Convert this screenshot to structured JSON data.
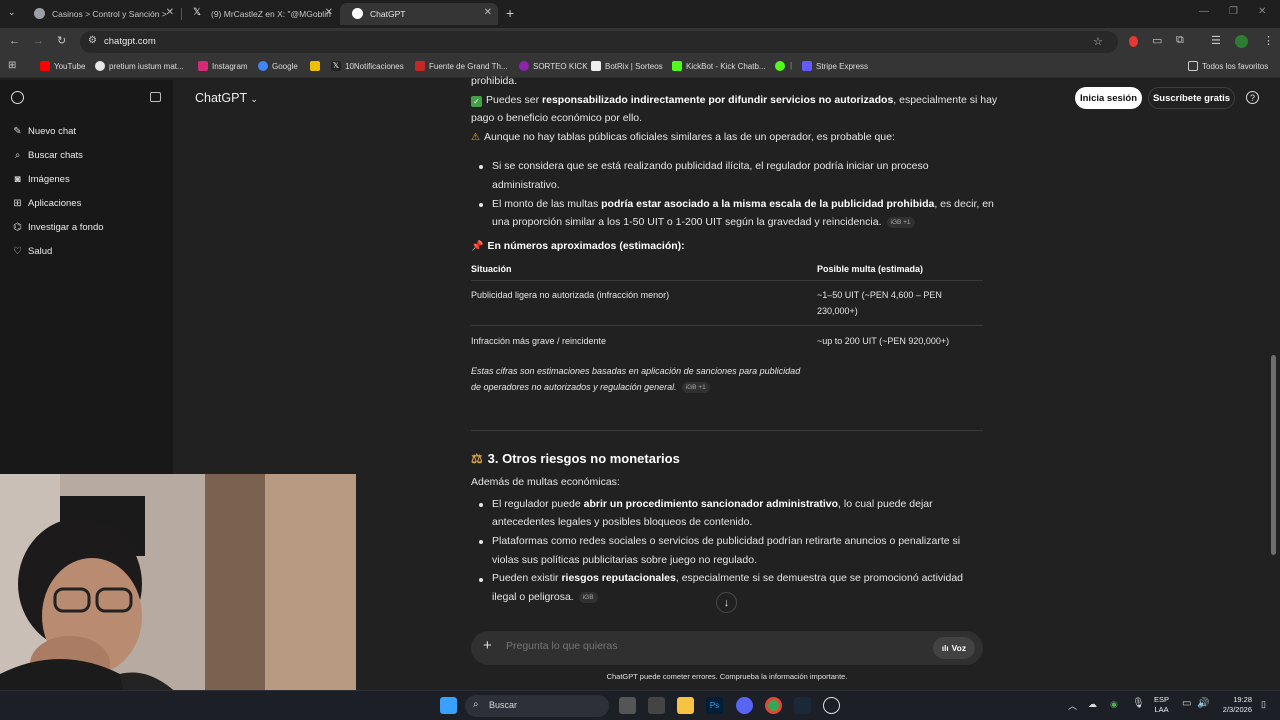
{
  "browser": {
    "tabs": [
      {
        "label": "Casinos > Control y Sanción >",
        "favicon_color": "#9aa0a6"
      },
      {
        "label": "(9) MrCastleZ en X: \"@MGoblin",
        "favicon_color": "#ffffff"
      },
      {
        "label": "ChatGPT",
        "favicon_color": "#ffffff",
        "active": true
      }
    ],
    "url": "chatgpt.com",
    "bookmarks": [
      {
        "label": "YouTube",
        "color": "#ff0000"
      },
      {
        "label": "pretium iustum mat...",
        "color": "#e8e8e8"
      },
      {
        "label": "Instagram",
        "color": "#d62976"
      },
      {
        "label": "Google",
        "color": "#4285f4"
      },
      {
        "label": "",
        "color": "#f0c000"
      },
      {
        "label": "10Notificaciones",
        "color": "#222222"
      },
      {
        "label": "Fuente de Grand Th...",
        "color": "#c62828"
      },
      {
        "label": "SORTEO KICK",
        "color": "#8e24aa"
      },
      {
        "label": "BotRix | Sorteos",
        "color": "#eeeeee"
      },
      {
        "label": "KickBot - Kick Chatb...",
        "color": "#53fc18"
      },
      {
        "label": "",
        "color": "#53fc18"
      },
      {
        "label": "Stripe Express",
        "color": "#635bff"
      }
    ],
    "all_bookmarks": "Todos los favoritos"
  },
  "sidebar": {
    "items": [
      {
        "label": "Nuevo chat",
        "icon": "edit-icon"
      },
      {
        "label": "Buscar chats",
        "icon": "search-icon"
      },
      {
        "label": "Imágenes",
        "icon": "images-icon"
      },
      {
        "label": "Aplicaciones",
        "icon": "apps-icon"
      },
      {
        "label": "Investigar a fondo",
        "icon": "telescope-icon"
      },
      {
        "label": "Salud",
        "icon": "heart-icon"
      }
    ]
  },
  "header": {
    "title": "ChatGPT",
    "login": "Inicia sesión",
    "subscribe": "Suscríbete gratis"
  },
  "content": {
    "line_top_cut": "prohibida.",
    "check_pre": "Puedes ser ",
    "check_bold": "responsabilizado indirectamente por difundir servicios no autorizados",
    "check_post": ", especialmente si hay",
    "check_line2": "pago o beneficio económico por ello.",
    "warn_line": "Aunque no hay tablas públicas oficiales similares a las de un operador, es probable que:",
    "b1_line1": "Si se considera que se está realizando publicidad ilícita, el regulador podría iniciar un proceso",
    "b1_line2": "administrativo.",
    "b2_pre": "El monto de las multas ",
    "b2_bold": "podría estar asociado a la misma escala de la publicidad prohibida",
    "b2_post": ", es decir, en",
    "b2_line2": "una proporción similar a los 1-50 UIT o 1-200 UIT según la gravedad y reincidencia.",
    "b2_chip": "iGB +1",
    "pin_heading": "En números aproximados (estimación):",
    "table": {
      "headers": [
        "Situación",
        "Posible multa (estimada)"
      ],
      "rows": [
        {
          "situacion": "Publicidad ligera no autorizada (infracción menor)",
          "multa_l1": "~1–50 UIT (~PEN 4,600 – PEN",
          "multa_l2": "230,000+)"
        },
        {
          "situacion": "Infracción más grave / reincidente",
          "multa_l1": "~up to 200 UIT (~PEN 920,000+)",
          "multa_l2": ""
        }
      ]
    },
    "note_l1": "Estas cifras son estimaciones basadas en aplicación de sanciones para publicidad",
    "note_l2": "de operadores no autorizados y regulación general.",
    "note_chip": "iGB +1",
    "section3": "3. Otros riesgos no monetarios",
    "s3_intro": "Además de multas económicas:",
    "s3_b1_pre": "El regulador puede ",
    "s3_b1_bold": "abrir un procedimiento sancionador administrativo",
    "s3_b1_post": ", lo cual puede dejar",
    "s3_b1_l2": "antecedentes legales y posibles bloqueos de contenido.",
    "s3_b2_l1": "Plataformas como redes sociales o servicios de publicidad podrían retirarte anuncios o penalizarte si",
    "s3_b2_l2": "violas sus políticas publicitarias sobre juego no regulado.",
    "s3_b3_pre": "Pueden existir ",
    "s3_b3_bold": "riesgos reputacionales",
    "s3_b3_post": ", especialmente si se demuestra que se promocionó actividad",
    "s3_b3_l2": "ilegal o peligrosa.",
    "s3_chip": "iGB"
  },
  "composer": {
    "placeholder": "Pregunta lo que quieras",
    "voice": "Voz",
    "disclaimer": "ChatGPT puede cometer errores. Comprueba la información importante."
  },
  "taskbar": {
    "search": "Buscar",
    "lang1": "ESP",
    "lang2": "LAA",
    "time": "19:28",
    "date": "2/3/2026"
  }
}
